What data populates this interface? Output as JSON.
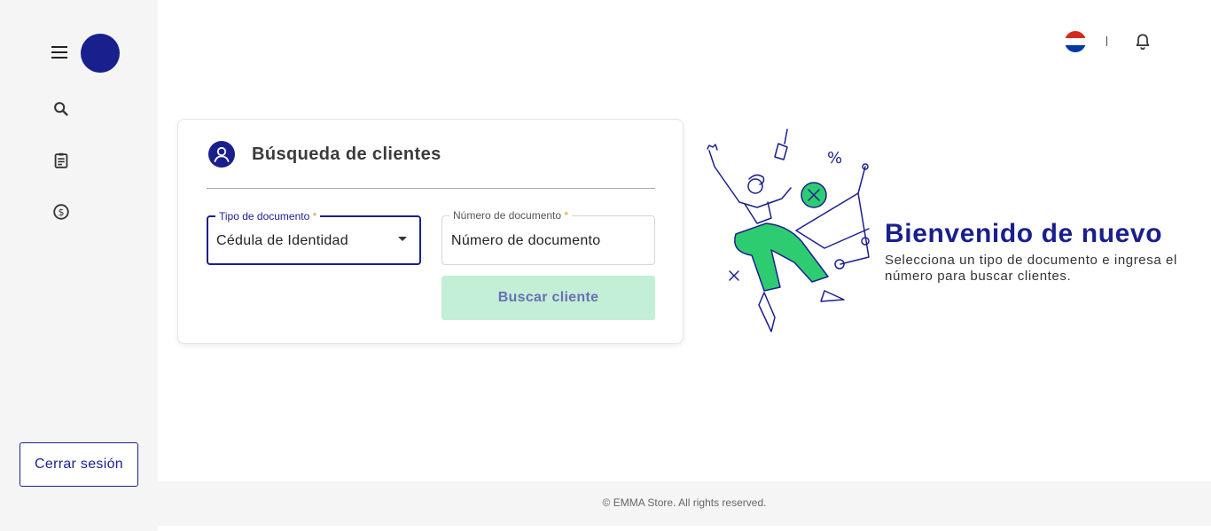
{
  "sidebar": {
    "icons": [
      "menu-icon",
      "search-icon",
      "clipboard-icon",
      "dollar-icon"
    ],
    "logout_label": "Cerrar sesión",
    "avatar_color": "#1a1f8e"
  },
  "topbar": {
    "flag": "paraguay-flag-icon",
    "notification": "bell-icon"
  },
  "search_card": {
    "title": "Búsqueda de clientes",
    "doc_type": {
      "label": "Tipo de documento",
      "required_mark": "*",
      "selected": "Cédula de Identidad"
    },
    "doc_number": {
      "label": "Número de documento",
      "required_mark": "*",
      "placeholder": "Número de documento"
    },
    "search_button": "Buscar cliente"
  },
  "welcome": {
    "title": "Bienvenido de nuevo",
    "text": "Selecciona un tipo de documento e ingresa el número para buscar clientes."
  },
  "footer": {
    "text": "© EMMA Store. All rights reserved."
  },
  "colors": {
    "brand": "#1a1f8e",
    "accent_green": "#2ecc71",
    "button_disabled_bg": "#c2efd6"
  }
}
